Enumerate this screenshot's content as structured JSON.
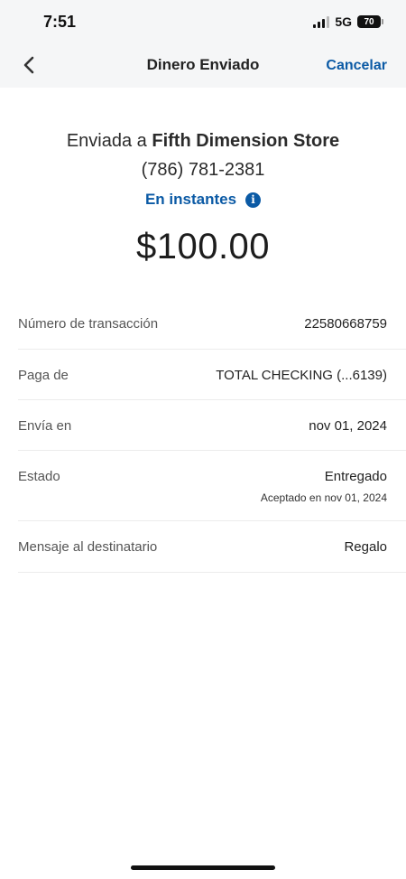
{
  "status_bar": {
    "time": "7:51",
    "network": "5G",
    "battery": "70"
  },
  "header": {
    "title": "Dinero Enviado",
    "cancel_label": "Cancelar",
    "back_icon": "chevron-left-icon"
  },
  "summary": {
    "sent_to_prefix": "Enviada a",
    "recipient_name": "Fifth Dimension Store",
    "phone": "(786) 781-2381",
    "delivery_speed": "En instantes",
    "info_icon": "info-icon",
    "amount": "$100.00"
  },
  "details": [
    {
      "label": "Número de transacción",
      "value": "22580668759",
      "sub": ""
    },
    {
      "label": "Paga de",
      "value": "TOTAL CHECKING (...6139)",
      "sub": ""
    },
    {
      "label": "Envía en",
      "value": "nov 01, 2024",
      "sub": ""
    },
    {
      "label": "Estado",
      "value": "Entregado",
      "sub": "Aceptado en nov 01, 2024"
    },
    {
      "label": "Mensaje al destinatario",
      "value": "Regalo",
      "sub": ""
    }
  ],
  "colors": {
    "accent": "#0b5aa5",
    "header_bg": "#f5f6f7"
  }
}
